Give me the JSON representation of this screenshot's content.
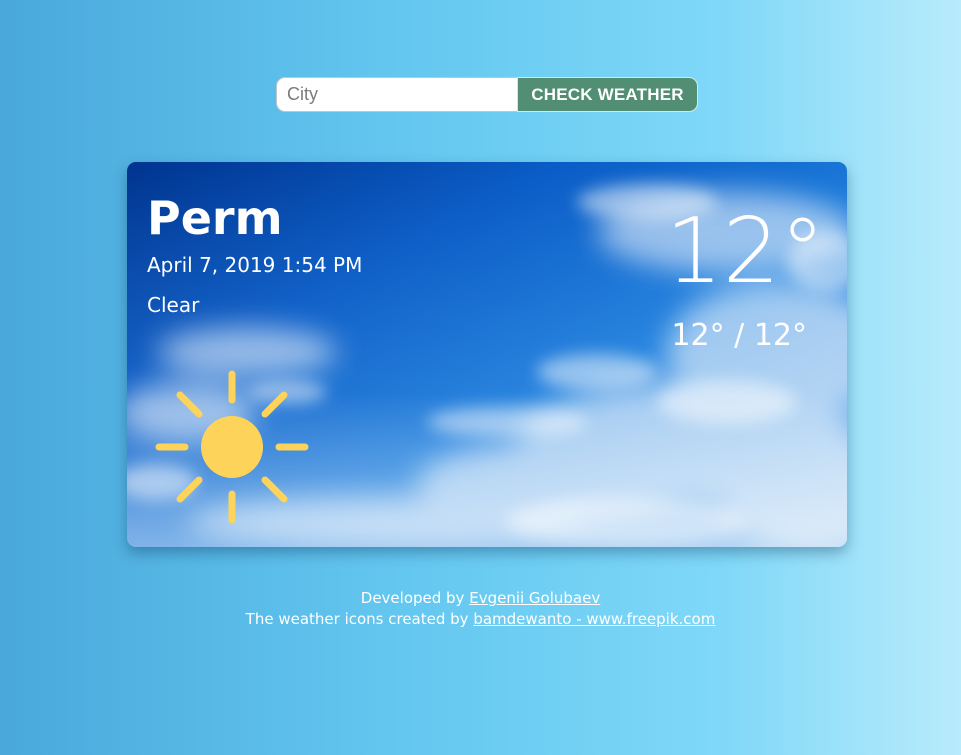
{
  "search": {
    "placeholder": "City",
    "button_label": "CHECK WEATHER"
  },
  "weather": {
    "city": "Perm",
    "datetime": "April 7, 2019 1:54 PM",
    "condition": "Clear",
    "temperature": "12°",
    "range": "12° / 12°",
    "icon": "sun-icon"
  },
  "footer": {
    "developed_prefix": "Developed by",
    "developer_name": "Evgenii Golubaev",
    "icons_prefix": "The weather icons created by",
    "icons_credit": "bamdewanto - www.freepik.com"
  },
  "colors": {
    "button": "#528e74",
    "sun": "#fdd35a",
    "sky": "#1570d4"
  }
}
